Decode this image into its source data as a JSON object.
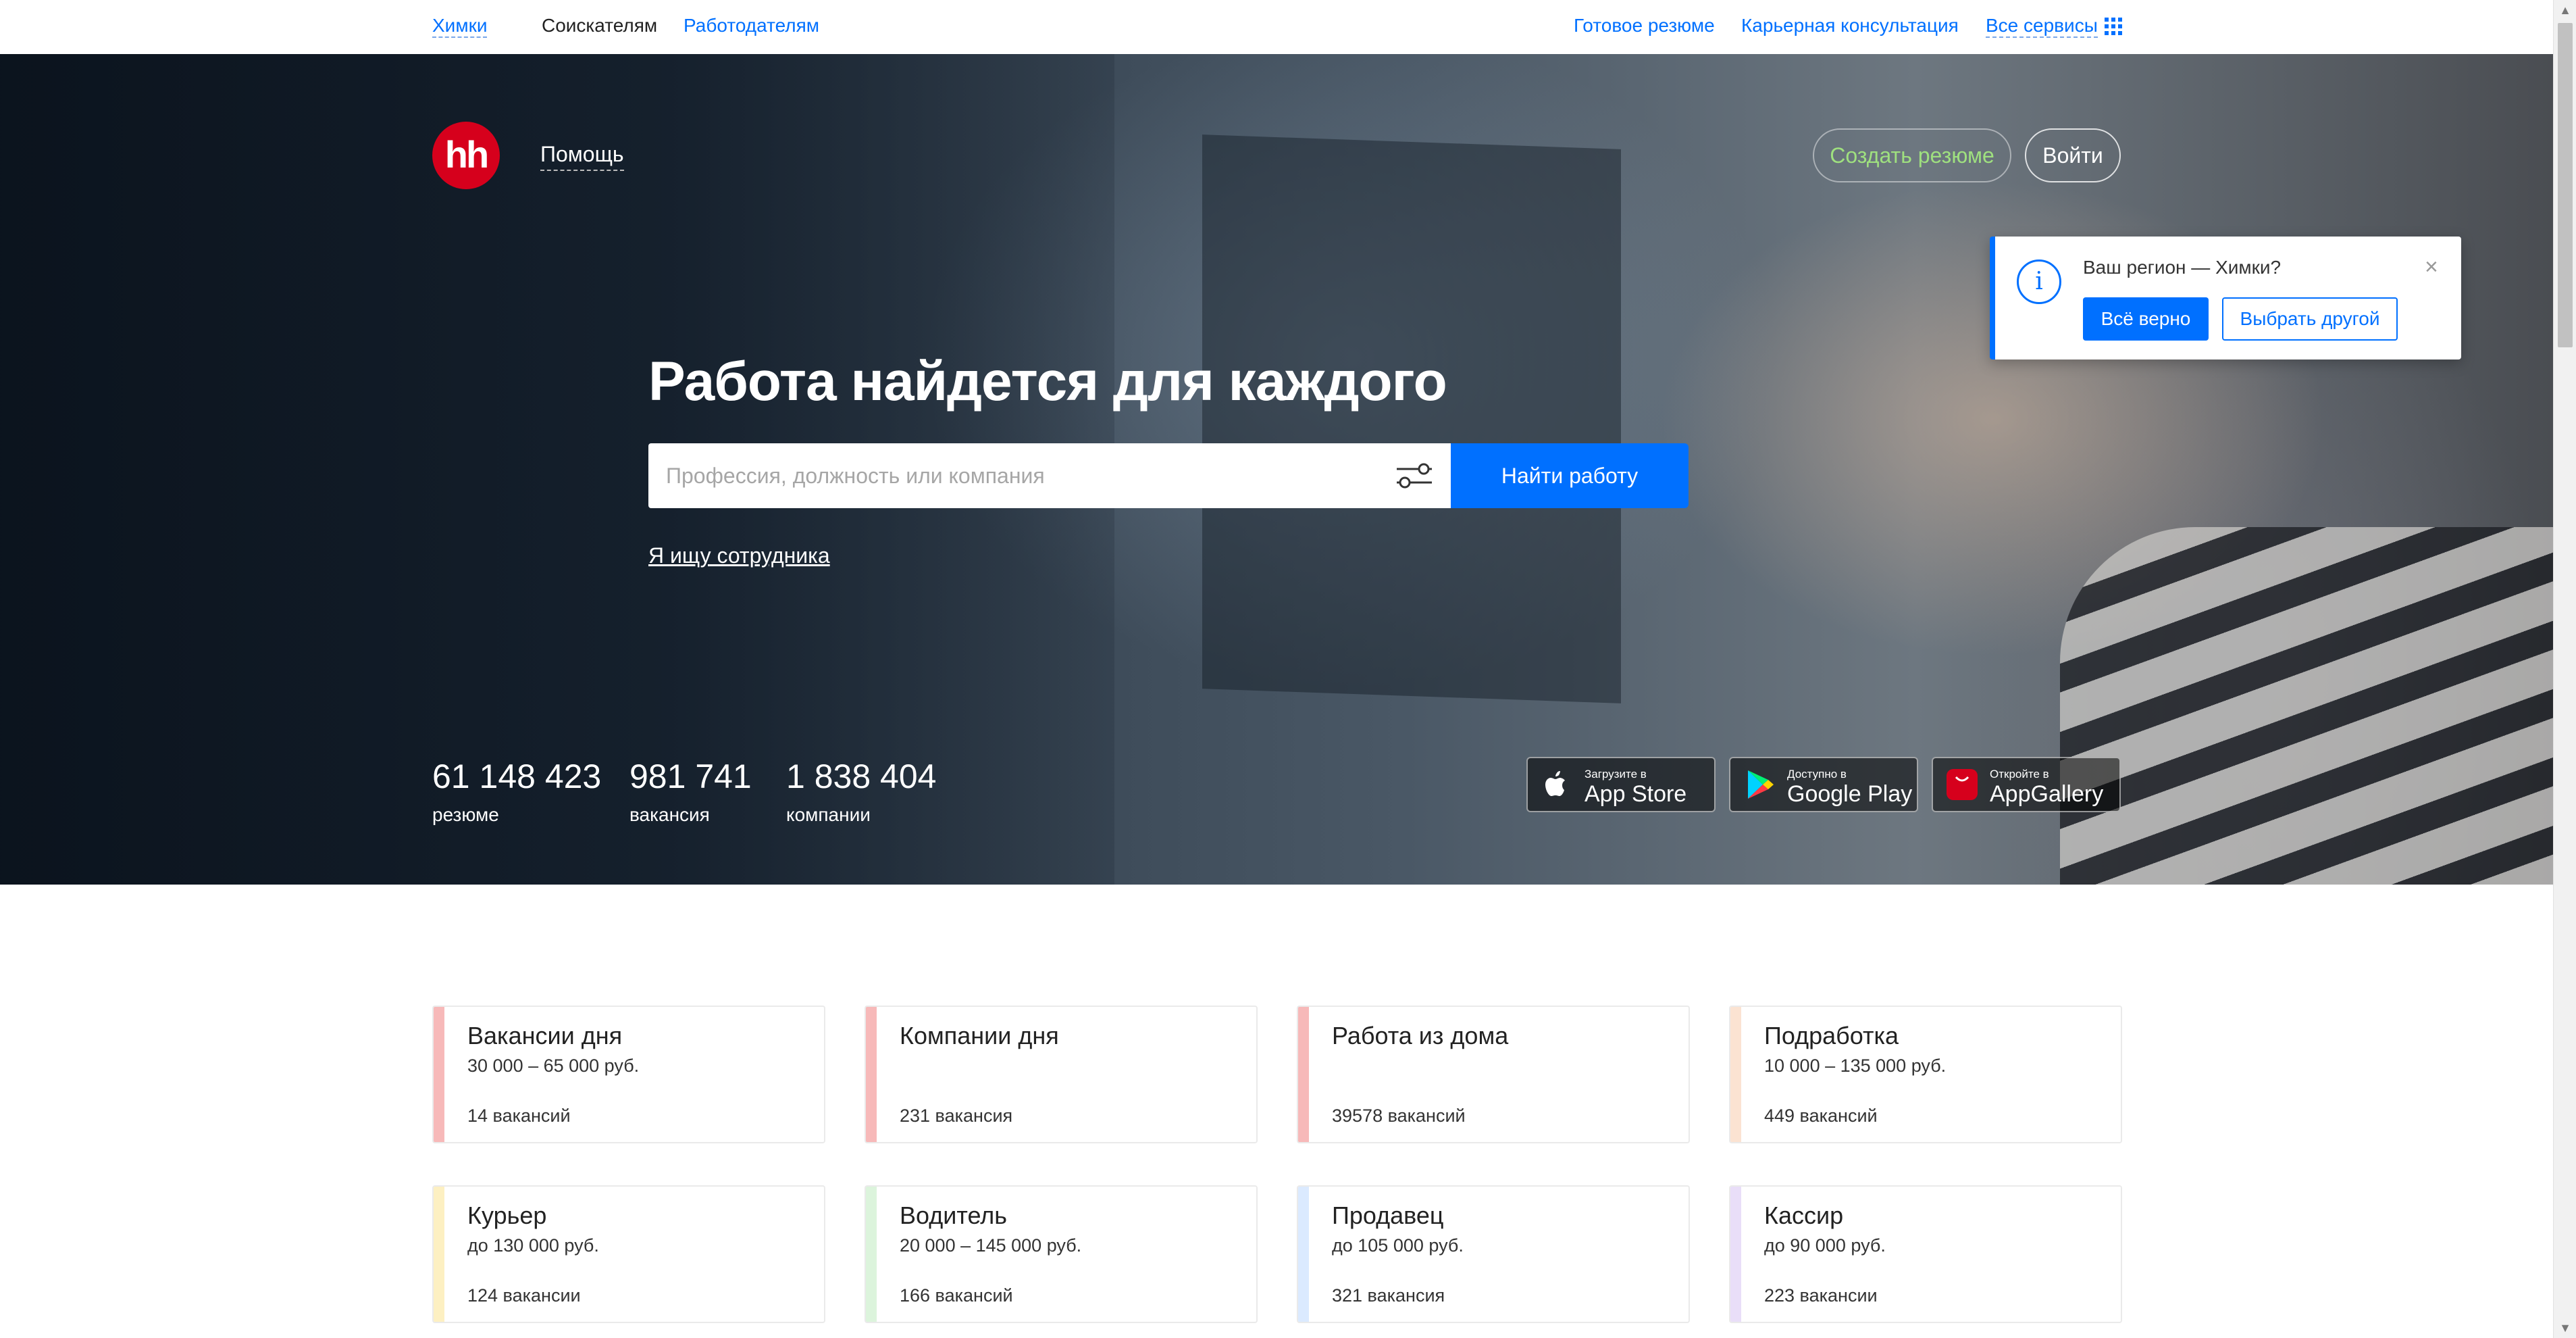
{
  "topbar": {
    "city": "Химки",
    "seekers": "Соискателям",
    "employers": "Работодателям",
    "ready_resume": "Готовое резюме",
    "career_consult": "Карьерная консультация",
    "all_services": "Все сервисы"
  },
  "header": {
    "logo": "hh",
    "help": "Помощь",
    "create_resume": "Создать резюме",
    "login": "Войти"
  },
  "hero": {
    "headline": "Работа найдется для каждого",
    "search_placeholder": "Профессия, должность или компания",
    "search_button": "Найти работу",
    "employer_link": "Я ищу сотрудника"
  },
  "stats": [
    {
      "value": "61 148 423",
      "label": "резюме"
    },
    {
      "value": "981 741",
      "label": "вакансия"
    },
    {
      "value": "1 838 404",
      "label": "компании"
    }
  ],
  "stores": [
    {
      "small": "Загрузите в",
      "big": "App Store",
      "icon": "apple-icon"
    },
    {
      "small": "Доступно в",
      "big": "Google Play",
      "icon": "google-play-icon"
    },
    {
      "small": "Откройте в",
      "big": "AppGallery",
      "icon": "huawei-icon"
    }
  ],
  "region_popup": {
    "question": "Ваш регион — Химки?",
    "confirm": "Всё верно",
    "choose_other": "Выбрать другой",
    "close": "×",
    "info": "i"
  },
  "cards": [
    {
      "title": "Вакансии дня",
      "subtitle": "30 000 – 65 000 руб.",
      "count": "14 вакансий",
      "color": "#f7b9b9"
    },
    {
      "title": "Компании дня",
      "subtitle": "",
      "count": "231 вакансия",
      "color": "#f7b9b9"
    },
    {
      "title": "Работа из дома",
      "subtitle": "",
      "count": "39578 вакансий",
      "color": "#f7b9b9"
    },
    {
      "title": "Подработка",
      "subtitle": "10 000 – 135 000 руб.",
      "count": "449 вакансий",
      "color": "#fbe3d2"
    },
    {
      "title": "Курьер",
      "subtitle": "до 130 000 руб.",
      "count": "124 вакансии",
      "color": "#fdf0c2"
    },
    {
      "title": "Водитель",
      "subtitle": "20 000 – 145 000 руб.",
      "count": "166 вакансий",
      "color": "#dcf4dc"
    },
    {
      "title": "Продавец",
      "subtitle": "до 105 000 руб.",
      "count": "321 вакансия",
      "color": "#dbeaff"
    },
    {
      "title": "Кассир",
      "subtitle": "до 90 000 руб.",
      "count": "223 вакансии",
      "color": "#e9def8"
    }
  ],
  "colors": {
    "accent": "#0070ff",
    "brand": "#d6001c",
    "create_resume_text": "#9fe07f"
  }
}
